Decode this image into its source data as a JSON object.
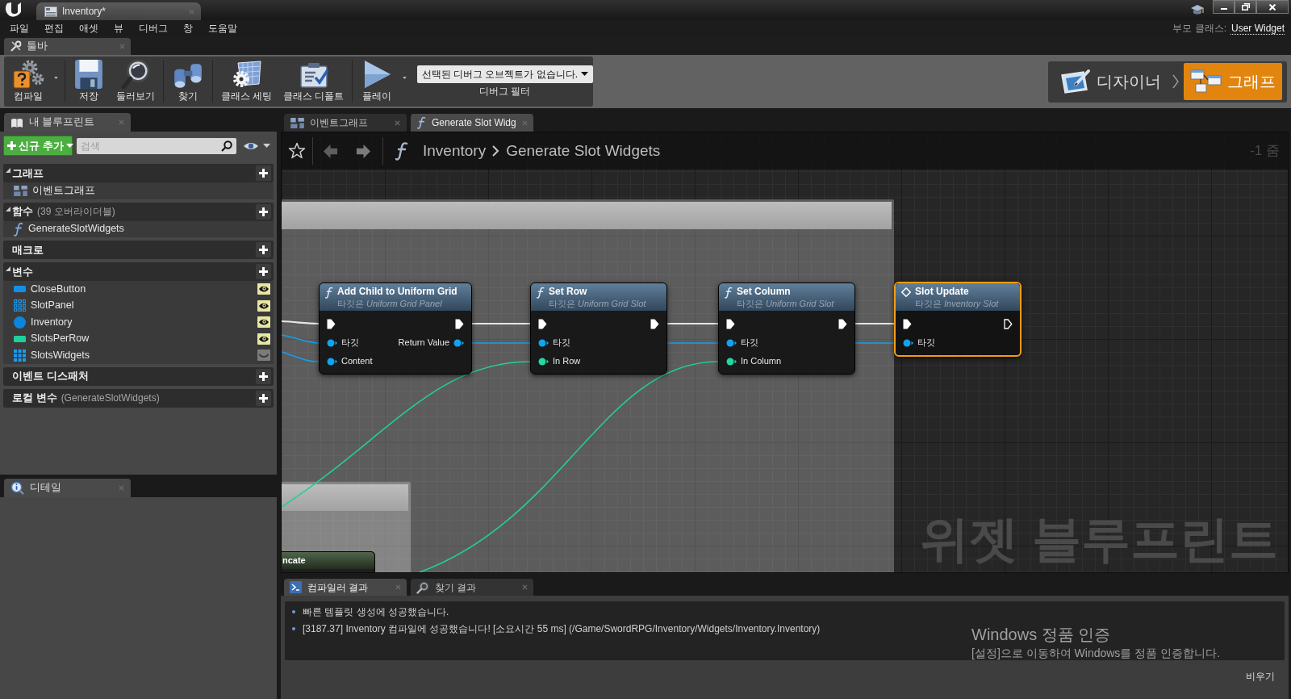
{
  "window": {
    "tab": "Inventory*"
  },
  "menu_bar": {
    "items": [
      "파일",
      "편집",
      "애셋",
      "뷰",
      "디버그",
      "창",
      "도움말"
    ],
    "parent_class_label": "부모 클래스:",
    "parent_class": "User Widget"
  },
  "toolbar_tab": "툴바",
  "toolbar": {
    "groups": [
      [
        {
          "label": "컴파일",
          "kind": "compile",
          "has_menu": true
        }
      ],
      [
        {
          "label": "저장",
          "kind": "save",
          "has_menu": false
        },
        {
          "label": "둘러보기",
          "kind": "browse",
          "has_menu": false
        }
      ],
      [
        {
          "label": "찾기",
          "kind": "find",
          "has_menu": false
        }
      ],
      [
        {
          "label": "클래스 세팅",
          "kind": "class_settings",
          "has_menu": false
        },
        {
          "label": "클래스 디폴트",
          "kind": "class_defaults",
          "has_menu": false
        }
      ],
      [
        {
          "label": "플레이",
          "kind": "play",
          "has_menu": true
        }
      ]
    ],
    "debug_filter": {
      "value": "선택된 디버그 오브젝트가 없습니다.",
      "label": "디버그 필터"
    }
  },
  "modes": [
    {
      "label": "디자이너",
      "kind": "designer",
      "selected": false
    },
    {
      "label": "그래프",
      "kind": "graph",
      "selected": true
    }
  ],
  "my_blueprint": {
    "tab": "내 블루프린트",
    "add_button": "신규 추가",
    "search": {
      "placeholder": "검색"
    },
    "sections": [
      {
        "title": "그래프",
        "items": [
          {
            "label": "이벤트그래프",
            "kind": "graph"
          }
        ]
      },
      {
        "title": "함수",
        "note": "(39 오버라이더블)",
        "items": [
          {
            "label": "GenerateSlotWidgets",
            "kind": "function"
          }
        ]
      },
      {
        "title": "매크로"
      },
      {
        "title": "변수",
        "items": [
          {
            "label": "CloseButton",
            "kind": "bar",
            "color": "#1190e6",
            "eye_open": true
          },
          {
            "label": "SlotPanel",
            "kind": "dotgrid",
            "color": "#1e9af0",
            "eye_open": true
          },
          {
            "label": "Inventory",
            "kind": "ball",
            "color": "#0b86de",
            "eye_open": true
          },
          {
            "label": "SlotsPerRow",
            "kind": "bar",
            "color": "#1fcf9c",
            "eye_open": true
          },
          {
            "label": "SlotsWidgets",
            "kind": "grid",
            "color": "#1e9af0",
            "eye_open": false
          }
        ]
      },
      {
        "title": "이벤트 디스패처"
      },
      {
        "title": "로컬 변수",
        "note": "(GenerateSlotWidgets)"
      }
    ]
  },
  "details": {
    "tab": "디테일"
  },
  "graph_tabs": [
    {
      "label": "이벤트그래프",
      "kind": "graph",
      "selected": false
    },
    {
      "label": "Generate Slot Widg",
      "kind": "function",
      "selected": true
    }
  ],
  "graph": {
    "breadcrumb": [
      "Inventory",
      "Generate Slot Widgets"
    ],
    "zoom": "-1 줌",
    "watermark": "위젯 블루프린트",
    "nodes": [
      {
        "title": "Add Child to Uniform Grid",
        "subtitle": "타깃은 *Uniform Grid Panel*",
        "kind": "function",
        "selected": false,
        "exec_out_connected": true,
        "inputs": [
          {
            "label": "타깃",
            "kind": "object"
          },
          {
            "label": "Content",
            "kind": "object"
          }
        ],
        "outputs": [
          {
            "label": "Return Value",
            "kind": "object"
          }
        ]
      },
      {
        "title": "Set Row",
        "subtitle": "타깃은 *Uniform Grid Slot*",
        "kind": "function",
        "selected": false,
        "exec_out_connected": true,
        "inputs": [
          {
            "label": "타깃",
            "kind": "object"
          },
          {
            "label": "In Row",
            "kind": "int"
          }
        ]
      },
      {
        "title": "Set Column",
        "subtitle": "타깃은 *Uniform Grid Slot*",
        "kind": "function",
        "selected": false,
        "exec_out_connected": true,
        "inputs": [
          {
            "label": "타깃",
            "kind": "object"
          },
          {
            "label": "In Column",
            "kind": "int"
          }
        ]
      },
      {
        "title": "Slot Update",
        "subtitle": "타깃은 *Inventory Slot*",
        "kind": "interface",
        "selected": true,
        "exec_out_connected": false,
        "inputs": [
          {
            "label": "타깃",
            "kind": "object"
          }
        ]
      }
    ],
    "clipped_node": {
      "title": "ncate"
    }
  },
  "output_tabs": [
    {
      "label": "컴파일러 결과",
      "kind": "compiler",
      "selected": true
    },
    {
      "label": "찾기 결과",
      "kind": "find",
      "selected": false
    }
  ],
  "compiler_log": {
    "lines": [
      "빠른 템플릿 생성에 성공했습니다.",
      "[3187.37] Inventory 컴파일에 성공했습니다! [소요시간 55 ms] (/Game/SwordRPG/Inventory/Widgets/Inventory.Inventory)"
    ],
    "clear_button": "비우기"
  },
  "os_notice": {
    "title": "Windows 정품 인증",
    "message": "[설정]으로 이동하여 Windows를 정품 인증합니다."
  }
}
